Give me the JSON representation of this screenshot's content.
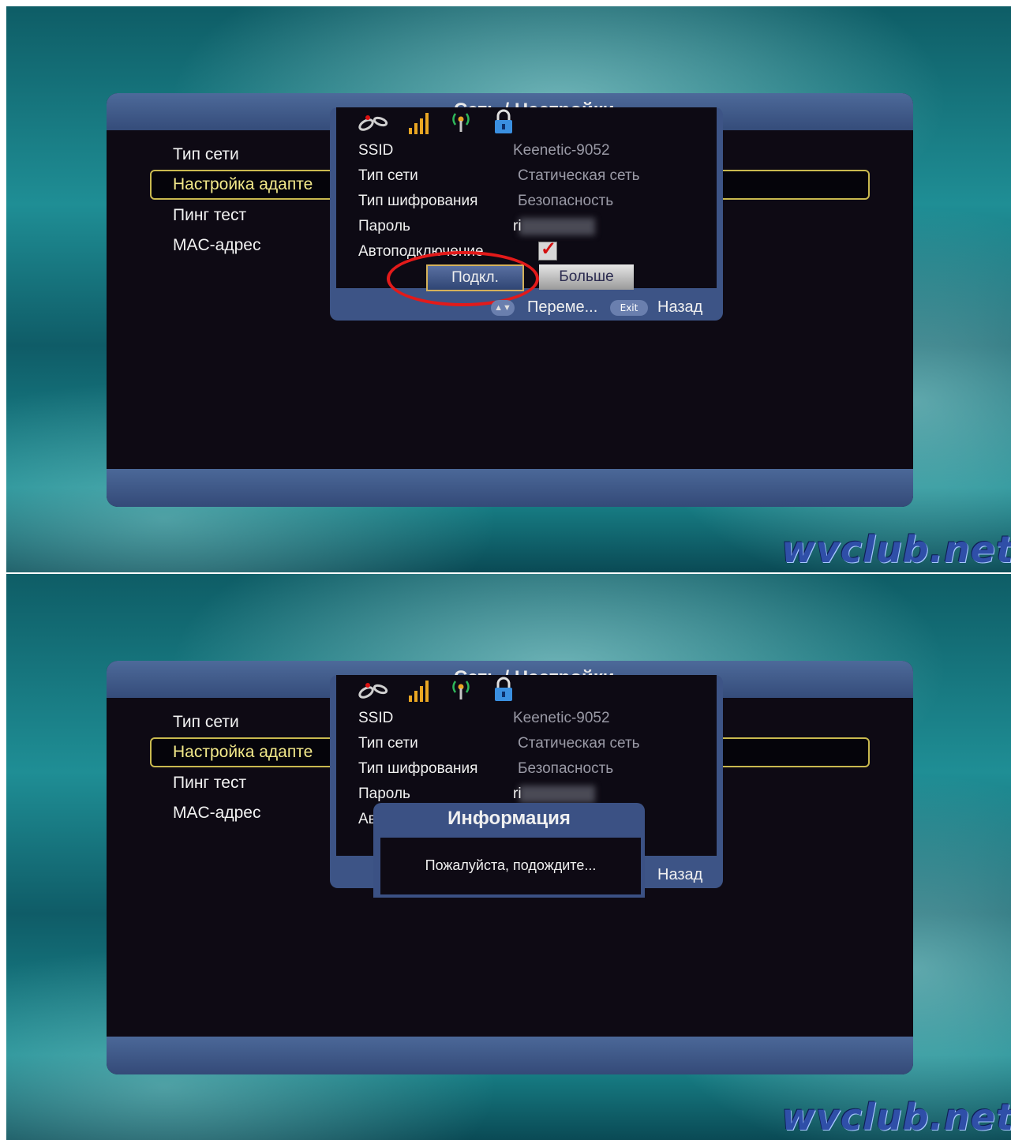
{
  "screens": [
    {
      "main_title": "Сеть / Настройки",
      "menu": [
        "Тип сети",
        "Настройка адаптера",
        "Пинг тест",
        "MAC-адрес"
      ],
      "menu_selected_visible": "Настройка адапте",
      "dialog": {
        "fields": [
          {
            "label": "SSID",
            "value": "Keenetic-9052"
          },
          {
            "label": "Тип сети",
            "value": "Статическая сеть"
          },
          {
            "label": "Тип шифрования",
            "value": "Безопасность"
          },
          {
            "label": "Пароль",
            "value": "ri"
          },
          {
            "label": "Автоподключение",
            "value": ""
          }
        ],
        "autoconnect_checked": true,
        "buttons": {
          "connect": "Подкл.",
          "more": "Больше"
        },
        "hints": {
          "arrows": "▲▼",
          "move": "Переме...",
          "exit": "Exit",
          "back": "Назад"
        }
      }
    },
    {
      "main_title": "Сеть / Настройки",
      "menu": [
        "Тип сети",
        "Настройка адаптера",
        "Пинг тест",
        "MAC-адрес"
      ],
      "menu_selected_visible": "Настройка адапте",
      "dialog": {
        "fields": [
          {
            "label": "SSID",
            "value": "Keenetic-9052"
          },
          {
            "label": "Тип сети",
            "value": "Статическая сеть"
          },
          {
            "label": "Тип шифрования",
            "value": "Безопасность"
          },
          {
            "label": "Пароль",
            "value": "ri"
          },
          {
            "label": "Авт",
            "value": ""
          }
        ],
        "hints": {
          "back": "Назад"
        }
      },
      "info_popup": {
        "title": "Информация",
        "message": "Пожалуйста, подождите..."
      }
    }
  ],
  "watermark": "wvclub.net",
  "colors": {
    "selection_border": "#c9b94f",
    "selection_text": "#f3e98a",
    "panel_bar": "#3d5486",
    "signal": "#e9a623",
    "highlight_oval": "#e31a1a"
  },
  "icons": [
    "satellite-dish-icon",
    "signal-bars-icon",
    "wifi-antenna-icon",
    "lock-icon"
  ]
}
